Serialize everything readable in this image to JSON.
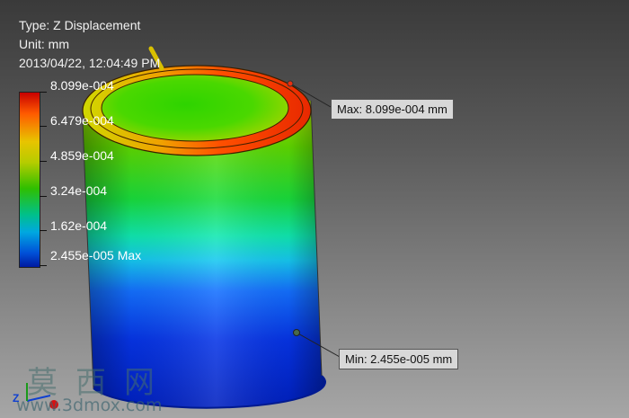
{
  "info": {
    "type_line": "Type: Z Displacement",
    "unit_line": "Unit: mm",
    "timestamp": "2013/04/22, 12:04:49 PM"
  },
  "legend": {
    "labels": [
      "8.099e-004",
      "6.479e-004",
      "4.859e-004",
      "3.24e-004",
      "1.62e-004",
      "2.455e-005 Max"
    ]
  },
  "callouts": {
    "max": "Max: 8.099e-004 mm",
    "min": "Min: 2.455e-005 mm"
  },
  "triad": {
    "z_label": "Z"
  },
  "watermark": {
    "chinese": "莫西网",
    "url": "www.3dmox.com"
  },
  "colors": {
    "max_red": "#e83010",
    "min_blue": "#0026c8",
    "background_top": "#3a3a3a",
    "background_bottom": "#a6a6a6"
  }
}
